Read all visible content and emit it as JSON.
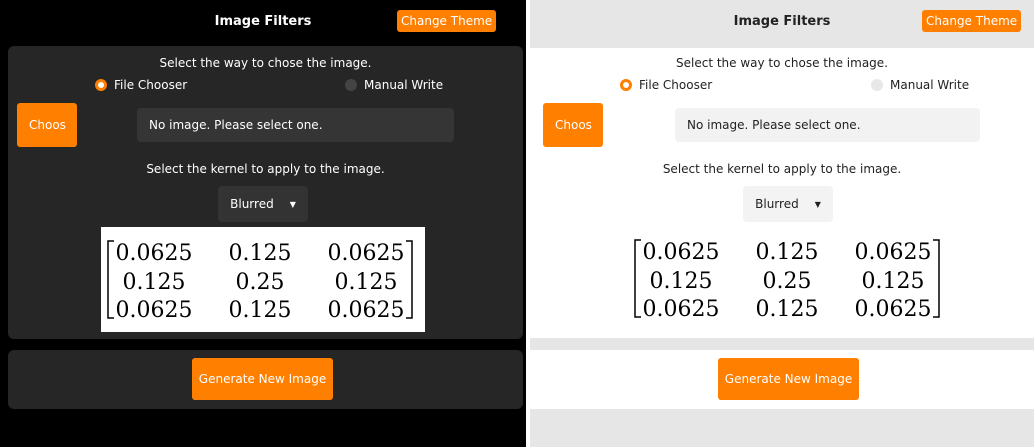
{
  "app": {
    "title": "Image Filters",
    "change_theme_label": "Change Theme"
  },
  "source_prompt": "Select the way to chose the image.",
  "source_options": [
    {
      "label": "File Chooser",
      "selected": true
    },
    {
      "label": "Manual Write",
      "selected": false
    }
  ],
  "choose_button_label": "Choos",
  "file_status": "No image. Please select one.",
  "kernel_prompt": "Select the kernel to apply to the image.",
  "kernel_select": {
    "value": "Blurred"
  },
  "kernel_matrix": [
    [
      "0.0625",
      "0.125",
      "0.0625"
    ],
    [
      "0.125",
      "0.25",
      "0.125"
    ],
    [
      "0.0625",
      "0.125",
      "0.0625"
    ]
  ],
  "generate_button_label": "Generate New Image",
  "colors": {
    "accent": "#ff7f00",
    "dark_background": "#000000",
    "dark_card": "#262626",
    "light_background": "#e6e6e6",
    "light_card": "#ffffff"
  }
}
